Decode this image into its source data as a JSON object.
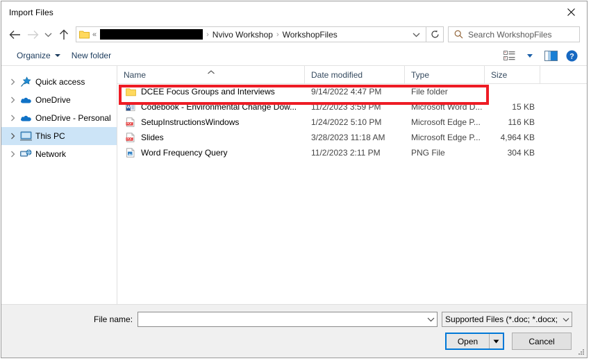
{
  "window": {
    "title": "Import Files",
    "close_icon": "close-icon"
  },
  "nav": {
    "back_icon": "back-arrow-icon",
    "forward_icon": "forward-arrow-icon",
    "recent_icon": "recent-locations-chevron-icon",
    "up_icon": "up-arrow-icon",
    "refresh_icon": "refresh-icon",
    "address_dropdown_icon": "chevron-down-icon",
    "folder_icon": "folder-icon",
    "overflow_chevrons": "«",
    "breadcrumbs": [
      {
        "label": "",
        "redacted": true
      },
      {
        "label": "Nvivo Workshop",
        "redacted": false
      },
      {
        "label": "WorkshopFiles",
        "redacted": false
      }
    ],
    "separator": "›"
  },
  "search": {
    "icon": "search-icon",
    "placeholder": "Search WorkshopFiles",
    "value": ""
  },
  "toolbar": {
    "organize_label": "Organize",
    "new_folder_label": "New folder",
    "view_icon": "view-layout-icon",
    "view_caret_icon": "chevron-down-icon",
    "preview_pane_icon": "preview-pane-icon",
    "help_icon": "help-icon"
  },
  "sidebar": {
    "items": [
      {
        "label": "Quick access",
        "icon": "star-pin-icon",
        "selected": false
      },
      {
        "label": "OneDrive",
        "icon": "cloud-icon",
        "selected": false
      },
      {
        "label": "OneDrive - Personal",
        "icon": "cloud-icon",
        "selected": false
      },
      {
        "label": "This PC",
        "icon": "computer-icon",
        "selected": true
      },
      {
        "label": "Network",
        "icon": "network-icon",
        "selected": false
      }
    ],
    "expander_icon": "chevron-right-icon"
  },
  "filelist": {
    "columns": [
      {
        "label": "Name",
        "sorted": "asc"
      },
      {
        "label": "Date modified",
        "sorted": ""
      },
      {
        "label": "Type",
        "sorted": ""
      },
      {
        "label": "Size",
        "sorted": ""
      }
    ],
    "sort_caret_icon": "sort-ascending-icon",
    "rows": [
      {
        "name": "DCEE Focus Groups and Interviews",
        "date": "9/14/2022 4:47 PM",
        "type": "File folder",
        "size": "",
        "icon": "folder-icon",
        "highlighted": true
      },
      {
        "name": "Codebook - Environmental Change Dow...",
        "date": "11/2/2023 3:59 PM",
        "type": "Microsoft Word D...",
        "size": "15 KB",
        "icon": "word-document-icon",
        "highlighted": false
      },
      {
        "name": "SetupInstructionsWindows",
        "date": "1/24/2022 5:10 PM",
        "type": "Microsoft Edge P...",
        "size": "116 KB",
        "icon": "pdf-file-icon",
        "highlighted": false
      },
      {
        "name": "Slides",
        "date": "3/28/2023 11:18 AM",
        "type": "Microsoft Edge P...",
        "size": "4,964 KB",
        "icon": "pdf-file-icon",
        "highlighted": false
      },
      {
        "name": "Word Frequency Query",
        "date": "11/2/2023 2:11 PM",
        "type": "PNG File",
        "size": "304 KB",
        "icon": "png-image-icon",
        "highlighted": false
      }
    ]
  },
  "footer": {
    "filename_label": "File name:",
    "filename_value": "",
    "filename_dropdown_icon": "chevron-down-icon",
    "filter_value": "Supported Files (*.doc; *.docx; ",
    "filter_dropdown_icon": "chevron-down-icon",
    "open_label": "Open",
    "open_split_icon": "caret-down-icon",
    "cancel_label": "Cancel",
    "resize_grip_icon": "resize-grip-icon"
  },
  "annotation": {
    "color": "#ee1c25",
    "target_row": "DCEE Focus Groups and Interviews"
  }
}
